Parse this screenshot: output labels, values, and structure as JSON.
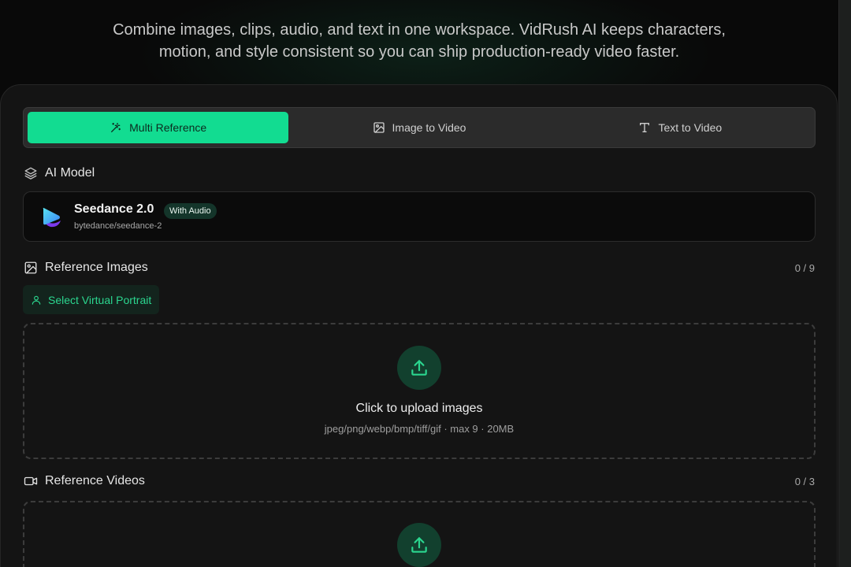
{
  "hero": {
    "subtitle_line1": "Combine images, clips, audio, and text in one workspace. VidRush AI keeps characters,",
    "subtitle_line2": "motion, and style consistent so you can ship production-ready video faster."
  },
  "tabs": [
    {
      "label": "Multi Reference",
      "icon": "magic-wand-icon",
      "active": true
    },
    {
      "label": "Image to Video",
      "icon": "image-icon",
      "active": false
    },
    {
      "label": "Text to Video",
      "icon": "text-icon",
      "active": false
    }
  ],
  "model": {
    "section_label": "AI Model",
    "name": "Seedance 2.0",
    "badge": "With Audio",
    "id": "bytedance/seedance-2"
  },
  "reference_images": {
    "section_label": "Reference Images",
    "counter": "0 / 9",
    "portrait_button": "Select Virtual Portrait",
    "upload_title": "Click to upload images",
    "upload_hint": "jpeg/png/webp/bmp/tiff/gif · max 9 · 20MB"
  },
  "reference_videos": {
    "section_label": "Reference Videos",
    "counter": "0 / 3"
  },
  "colors": {
    "accent": "#12dc91",
    "accent_text": "#2bd68f",
    "background": "#090909",
    "panel": "#141414"
  }
}
